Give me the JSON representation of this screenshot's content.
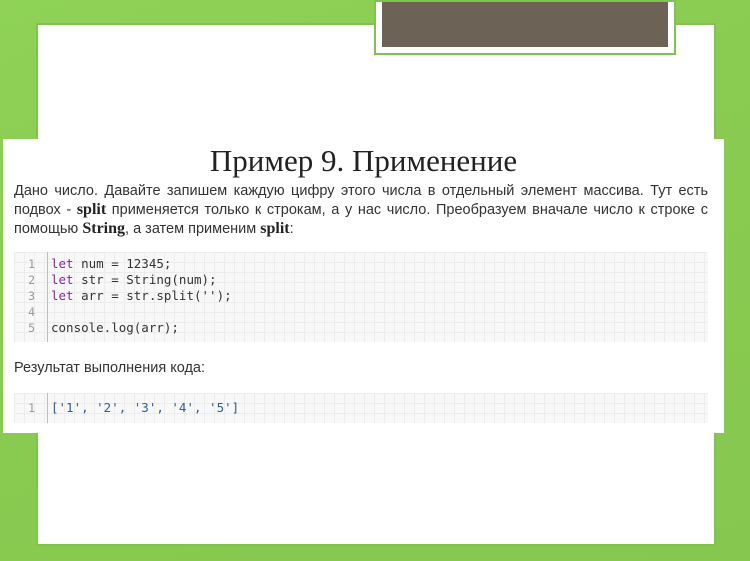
{
  "slide": {
    "title": "Пример 9. Применение",
    "paragraph": {
      "t1": "Дано число. Давайте запишем каждую цифру этого числа в отдельный элемент массива. Тут есть подвох - ",
      "b1": "split",
      "t2": " применяется только к строкам, а у нас число. Преобразуем вначале число к строке с помощью ",
      "b2": "String",
      "t3": ", а затем применим ",
      "b3": "split",
      "t4": ":"
    },
    "code_lines": [
      {
        "n": "1",
        "kw": "let",
        "rest": " num = 12345;"
      },
      {
        "n": "2",
        "kw": "let",
        "rest": " str = String(num);"
      },
      {
        "n": "3",
        "kw": "let",
        "rest": " arr = str.split('');"
      },
      {
        "n": "4",
        "kw": "",
        "rest": ""
      },
      {
        "n": "5",
        "kw": "",
        "rest": "console.log(arr);"
      }
    ],
    "result_label": "Результат выполнения кода:",
    "result_lines": [
      {
        "n": "1",
        "text": "['1', '2', '3', '4', '5']"
      }
    ]
  },
  "colors": {
    "background_green": "#8acb52",
    "title_bar": "#6d6256",
    "keyword": "#7a2fa0",
    "string": "#2a6099"
  }
}
